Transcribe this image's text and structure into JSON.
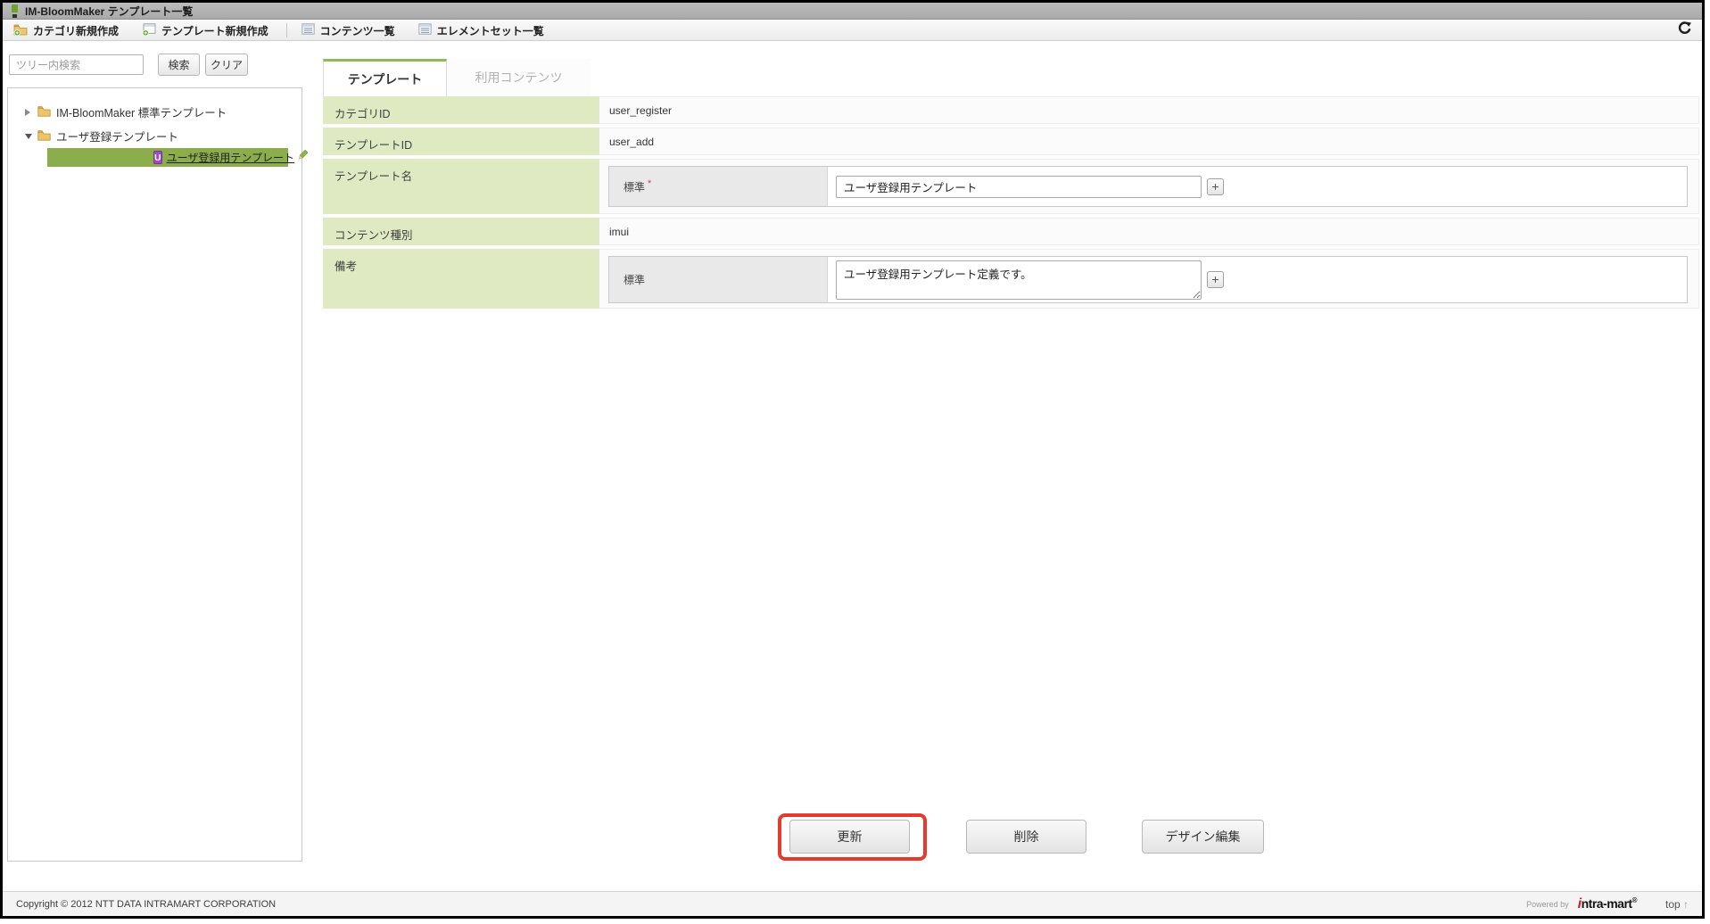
{
  "window": {
    "title": "IM-BloomMaker テンプレート一覧"
  },
  "toolbar": {
    "buttons": [
      {
        "label": "カテゴリ新規作成",
        "icon": "folder-add-icon"
      },
      {
        "label": "テンプレート新規作成",
        "icon": "template-add-icon"
      },
      {
        "label": "コンテンツ一覧",
        "icon": "list-icon"
      },
      {
        "label": "エレメントセット一覧",
        "icon": "list-icon"
      }
    ],
    "refresh_icon": "refresh-icon"
  },
  "sidebar": {
    "search": {
      "placeholder": "ツリー内検索",
      "search_button": "検索",
      "clear_button": "クリア"
    },
    "tree": [
      {
        "label": "IM-BloomMaker 標準テンプレート",
        "state": "collapsed",
        "icon": "folder-icon",
        "selected": false
      },
      {
        "label": "ユーザ登録テンプレート",
        "state": "expanded",
        "icon": "folder-icon",
        "selected": false
      },
      {
        "label": "ユーザ登録用テンプレート",
        "state": "leaf",
        "icon": "template-u-icon",
        "selected": true,
        "badge": "U",
        "edit_icon": "pencil-icon"
      }
    ]
  },
  "main": {
    "tabs": [
      {
        "label": "テンプレート",
        "active": true
      },
      {
        "label": "利用コンテンツ",
        "active": false
      }
    ],
    "fields": [
      {
        "label": "カテゴリID",
        "type": "static",
        "value": "user_register"
      },
      {
        "label": "テンプレートID",
        "type": "static",
        "value": "user_add"
      },
      {
        "label": "テンプレート名",
        "type": "locale-input",
        "sub_label": "標準",
        "required_mark": "*",
        "value": "ユーザ登録用テンプレート",
        "add_button": "+"
      },
      {
        "label": "コンテンツ種別",
        "type": "static",
        "value": "imui"
      },
      {
        "label": "備考",
        "type": "locale-textarea",
        "sub_label": "標準",
        "value": "ユーザ登録用テンプレート定義です。",
        "add_button": "+"
      }
    ],
    "actions": [
      {
        "label": "更新",
        "highlighted": true
      },
      {
        "label": "削除",
        "highlighted": false
      },
      {
        "label": "デザイン編集",
        "highlighted": false
      }
    ]
  },
  "footer": {
    "copyright": "Copyright © 2012 NTT DATA INTRAMART CORPORATION",
    "powered_by": "Powered by",
    "logo_prefix": "i",
    "logo_rest": "ntra-mart",
    "logo_reg": "®",
    "top_link": "top ",
    "top_arrow": "↑"
  },
  "colors": {
    "accent_green": "#92b85a",
    "selection_green": "#8bad4c",
    "label_cell_green": "#dfeac3",
    "highlight_red": "#e63b2c",
    "required_pink": "#e0316e"
  }
}
